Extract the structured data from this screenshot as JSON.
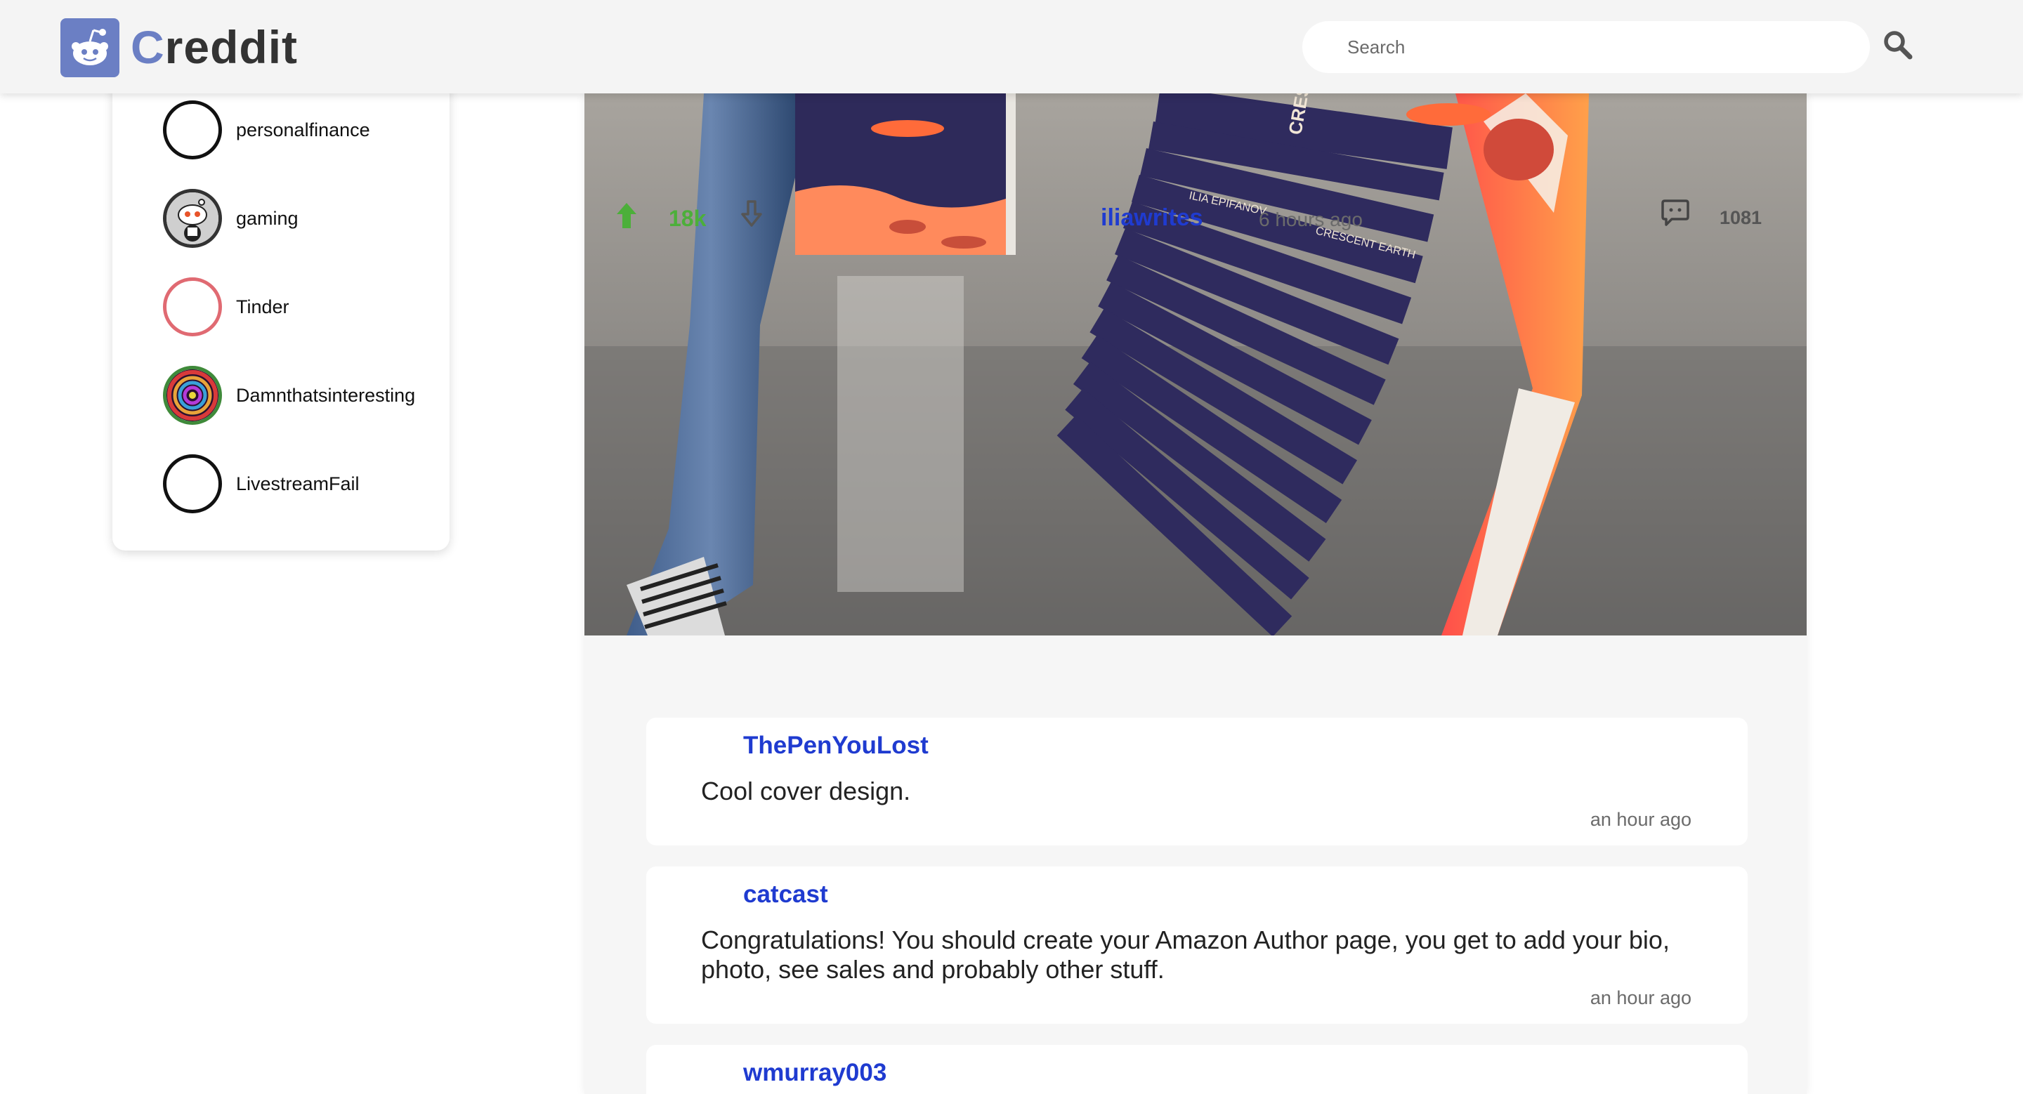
{
  "header": {
    "logo_text_first": "C",
    "logo_text_rest": "reddit",
    "search_placeholder": "Search"
  },
  "sidebar": {
    "items": [
      {
        "label": "personalfinance",
        "icon": "plain-ring-icon"
      },
      {
        "label": "gaming",
        "icon": "reddit-snoo-icon"
      },
      {
        "label": "Tinder",
        "icon": "pink-ring-icon"
      },
      {
        "label": "Damnthatsinteresting",
        "icon": "psychedelic-swirl-icon"
      },
      {
        "label": "LivestreamFail",
        "icon": "plain-ring-icon"
      }
    ]
  },
  "post": {
    "image_alt": "",
    "votes": "18k",
    "author": "iliawrites",
    "time": "6 hours ago",
    "comment_count": "1081",
    "colors": {
      "upvote": "#4caf3a",
      "author": "#1f3bd0"
    }
  },
  "comments": [
    {
      "author": "ThePenYouLost",
      "body": "Cool cover design.",
      "time": "an hour ago"
    },
    {
      "author": "catcast",
      "body": "Congratulations! You should create your Amazon Author page, you get to add your bio, photo, see sales and probably other stuff.",
      "time": "an hour ago"
    },
    {
      "author": "wmurray003",
      "body": "",
      "time": ""
    }
  ],
  "book_text": {
    "author_name": "ILIA EPIFANOV",
    "title": "CRESCENT EARTH"
  }
}
